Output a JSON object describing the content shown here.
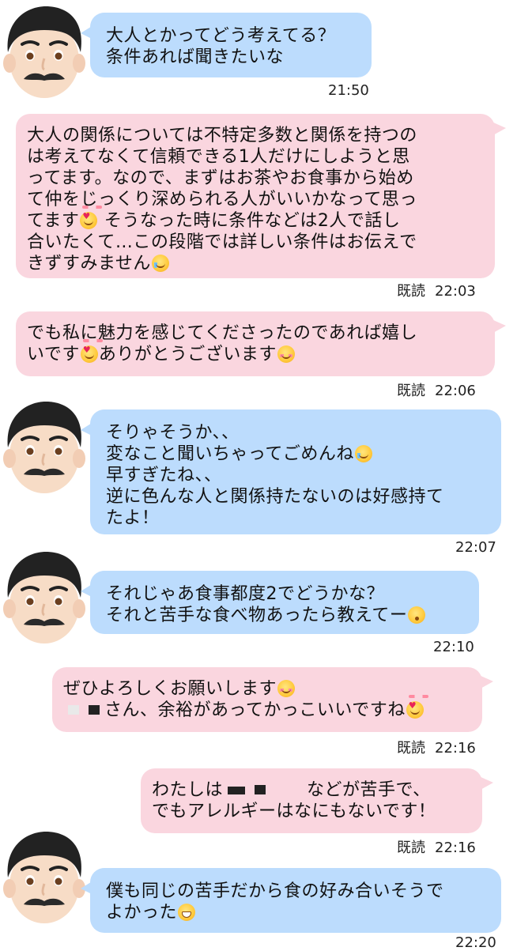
{
  "messages": [
    {
      "side": "in",
      "avatar": "man-mustache-avatar",
      "text_html": "大人とかってどう考えてる？<br>条件あれば聞きたいな",
      "time": "21:50"
    },
    {
      "side": "out",
      "text_html": "大人の関係については不特定多数と関係を持つの<br>は考えてなくて信頼できる1人だけにしようと思<br>ってます。なので、まずはお茶やお食事から始め<br>て仲をじっくり深められる人がいいかなって思っ<br>てます<span class='emo blush heart' data-name='smiling-face-with-hearts-icon' data-interactable='false'></span> そうなった時に条件などは2人で話し<br>合いたくて…この段階では詳しい条件はお伝えで<br>きずすみません<span class='emo cry' data-name='crying-face-icon' data-interactable='false'></span>",
      "read": "既読",
      "time": "22:03"
    },
    {
      "side": "out",
      "text_html": "でも私に魅力を感じてくださったのであれば嬉し<br>いです<span class='emo blush heart' data-name='smiling-face-with-hearts-icon' data-interactable='false'></span>ありがとうございます<span class='emo blush' data-name='smiling-face-icon' data-interactable='false'></span>",
      "read": "既読",
      "time": "22:06"
    },
    {
      "side": "in",
      "avatar": "man-mustache-avatar",
      "text_html": "そりゃそうか、、<br>変なこと聞いちゃってごめんね<span class='emo cry' data-name='crying-face-icon' data-interactable='false'></span><br>早すぎたね、、<br>逆に色んな人と関係持たないのは好感持て<br>たよ！",
      "time": "22:07"
    },
    {
      "side": "in",
      "avatar": "man-mustache-avatar",
      "text_html": "それじゃあ食事都度2でどうかな？<br>それと苦手な食べ物あったら教えてー<span class='emo kiss' data-name='kissing-face-icon' data-interactable='false'></span>",
      "time": "22:10"
    },
    {
      "side": "out",
      "text_html": "ぜひよろしくお願いします<span class='emo blush' data-name='smiling-face-icon' data-interactable='false'></span><br><span class='redact light' data-name='redacted-name' data-interactable='false'></span><span class='redact' data-name='redacted-name' data-interactable='false'></span>さん、余裕があってかっこいいですね<span class='emo blush heart' data-name='smiling-face-with-hearts-icon' data-interactable='false'></span>",
      "read": "既読",
      "time": "22:16"
    },
    {
      "side": "out",
      "text_html": "わたしは<span class='redact wide' data-name='redacted-food' data-interactable='false'></span><span class='redact' data-name='redacted-food' data-interactable='false'></span><span class='gap'></span>などが苦手で、<br>でもアレルギーはなにもないです！",
      "read": "既読",
      "time": "22:16"
    },
    {
      "side": "in",
      "avatar": "man-mustache-avatar",
      "text_html": "僕も同じの苦手だから食の好み合いそうで<br>よかった<span class='emo grin' data-name='grinning-face-icon' data-interactable='false'></span>",
      "time": "22:20"
    }
  ],
  "colors": {
    "incoming_bubble": "#bcdcfd",
    "outgoing_bubble": "#fad6df",
    "background": "#ffffff"
  }
}
